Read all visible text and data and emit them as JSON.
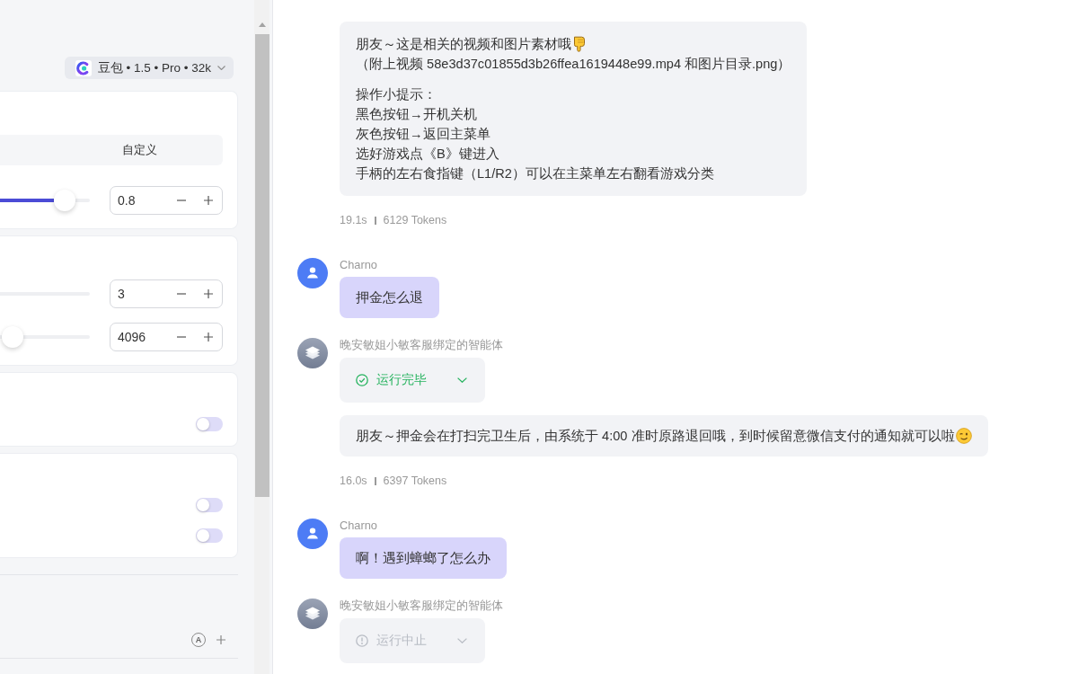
{
  "settings_panel": {
    "model_selector": {
      "label": "豆包 • 1.5 • Pro • 32k"
    },
    "cards": [
      {
        "segments": [
          {
            "label": "自定义",
            "selected": false
          }
        ],
        "rows": [
          {
            "kind": "slider",
            "level": 0.72,
            "value": "0.8"
          }
        ]
      },
      {
        "rows": [
          {
            "kind": "slider",
            "value": "3"
          },
          {
            "kind": "slider",
            "level": 0.14,
            "value": "4096"
          }
        ]
      },
      {
        "rows": [
          {
            "kind": "toggle",
            "on": false
          }
        ]
      },
      {
        "rows": [
          {
            "kind": "toggle",
            "on": false
          },
          {
            "kind": "toggle",
            "on": false
          }
        ]
      }
    ],
    "footer": {
      "badge": "A"
    }
  },
  "chat": {
    "messages": [
      {
        "kind": "agent",
        "text": {
          "kind": "point-down",
          "paragraphs": [
            [
              "朋友～这是相关的视频和图片素材哦",
              "（附上视频 58e3d37c01855d3b26ffea1619448e99.mp4 和图片目录.png）"
            ],
            [
              "操作小提示：",
              "黑色按钮→开机关机",
              "灰色按钮→返回主菜单",
              "选好游戏点《B》键进入",
              "手柄的左右食指键（L1/R2）可以在主菜单左右翻看游戏分类"
            ]
          ]
        },
        "meta": {
          "time": "19.1s",
          "tokens": "6129 Tokens"
        }
      },
      {
        "kind": "user",
        "author": "Charno",
        "text": {
          "kind": "plain",
          "paragraphs": [
            [
              "押金怎么退"
            ]
          ]
        }
      },
      {
        "kind": "agent",
        "author": "晚安敏姐小敏客服绑定的智能体",
        "status": {
          "kind": "done",
          "label": "运行完毕"
        },
        "text": {
          "kind": "wink",
          "paragraphs": [
            [
              "朋友～押金会在打扫完卫生后，由系统于 4:00 准时原路退回哦，到时候留意微信支付的通知就可以啦"
            ]
          ]
        },
        "meta": {
          "time": "16.0s",
          "tokens": "6397 Tokens"
        }
      },
      {
        "kind": "user",
        "author": "Charno",
        "text": {
          "kind": "plain",
          "paragraphs": [
            [
              "啊！遇到蟑螂了怎么办"
            ]
          ]
        }
      },
      {
        "kind": "agent",
        "author": "晚安敏姐小敏客服绑定的智能体",
        "status": {
          "kind": "stopped",
          "label": "运行中止"
        }
      }
    ]
  }
}
